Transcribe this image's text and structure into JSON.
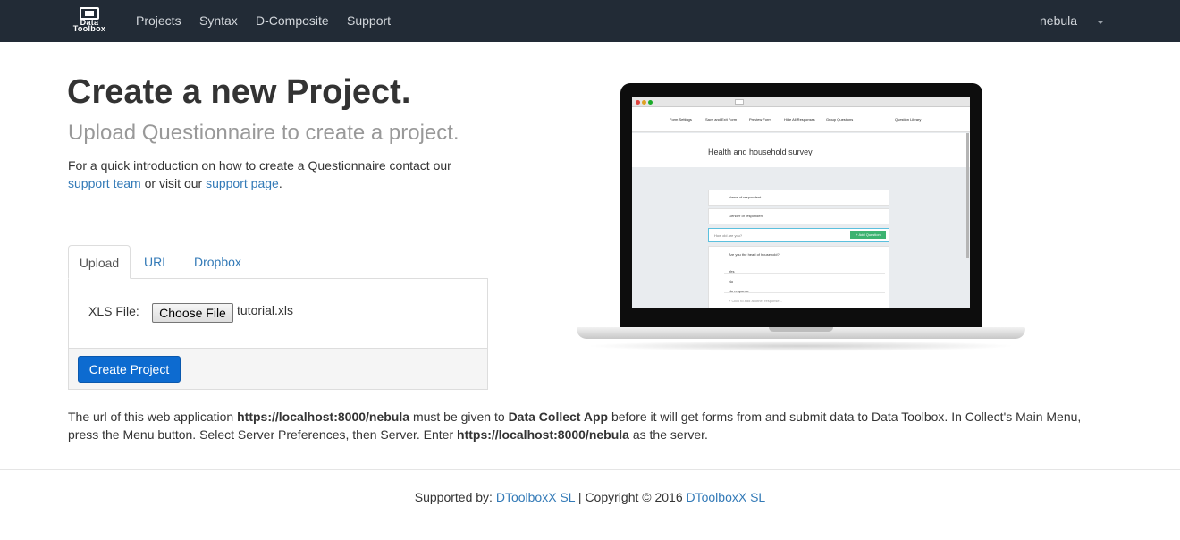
{
  "navbar": {
    "brand_line1": "Data",
    "brand_line2": "Toolbox",
    "items": [
      "Projects",
      "Syntax",
      "D-Composite",
      "Support"
    ],
    "user": "nebula"
  },
  "hero": {
    "title": "Create a new Project.",
    "subtitle": "Upload Questionnaire to create a project.",
    "intro_text": "For a quick introduction on how to create a Questionnaire contact our",
    "support_team_link": "support team",
    "intro_mid": "or visit our",
    "support_page_link": "support page",
    "intro_end": "."
  },
  "upload": {
    "tabs": [
      "Upload",
      "URL",
      "Dropbox"
    ],
    "active_tab": "Upload",
    "xls_label": "XLS File:",
    "choose_file_label": "Choose File",
    "file_name": "tutorial.xls",
    "create_button": "Create Project"
  },
  "preview": {
    "toolbar_items": [
      "Form Settings",
      "Save and Exit Form",
      "Preview Form",
      "Hide All Responses",
      "Group Questions",
      "Question Library"
    ],
    "form_title": "Health and household survey",
    "questions": [
      "Name of respondent",
      "Gender of respondent"
    ],
    "new_question_placeholder": "How old are you?",
    "add_question_label": "+ Add Question",
    "select_question": "Are you the head of household?",
    "options": [
      "Yes",
      "No",
      "No response"
    ],
    "add_option_hint": "+ Click to add another response..."
  },
  "info": {
    "p1": "The url of this web application",
    "url1": "https://localhost:8000/nebula",
    "p2": "must be given to",
    "app": "Data Collect App",
    "p3": "before it will get forms from and submit data to Data Toolbox. In Collect's Main Menu, press the Menu button. Select Server Preferences, then Server. Enter",
    "url2": "https://localhost:8000/nebula",
    "p4": "as the server."
  },
  "footer": {
    "supported_by": "Supported by:",
    "link1": "DToolboxX SL",
    "copyright": "| Copyright © 2016",
    "link2": "DToolboxX SL"
  }
}
